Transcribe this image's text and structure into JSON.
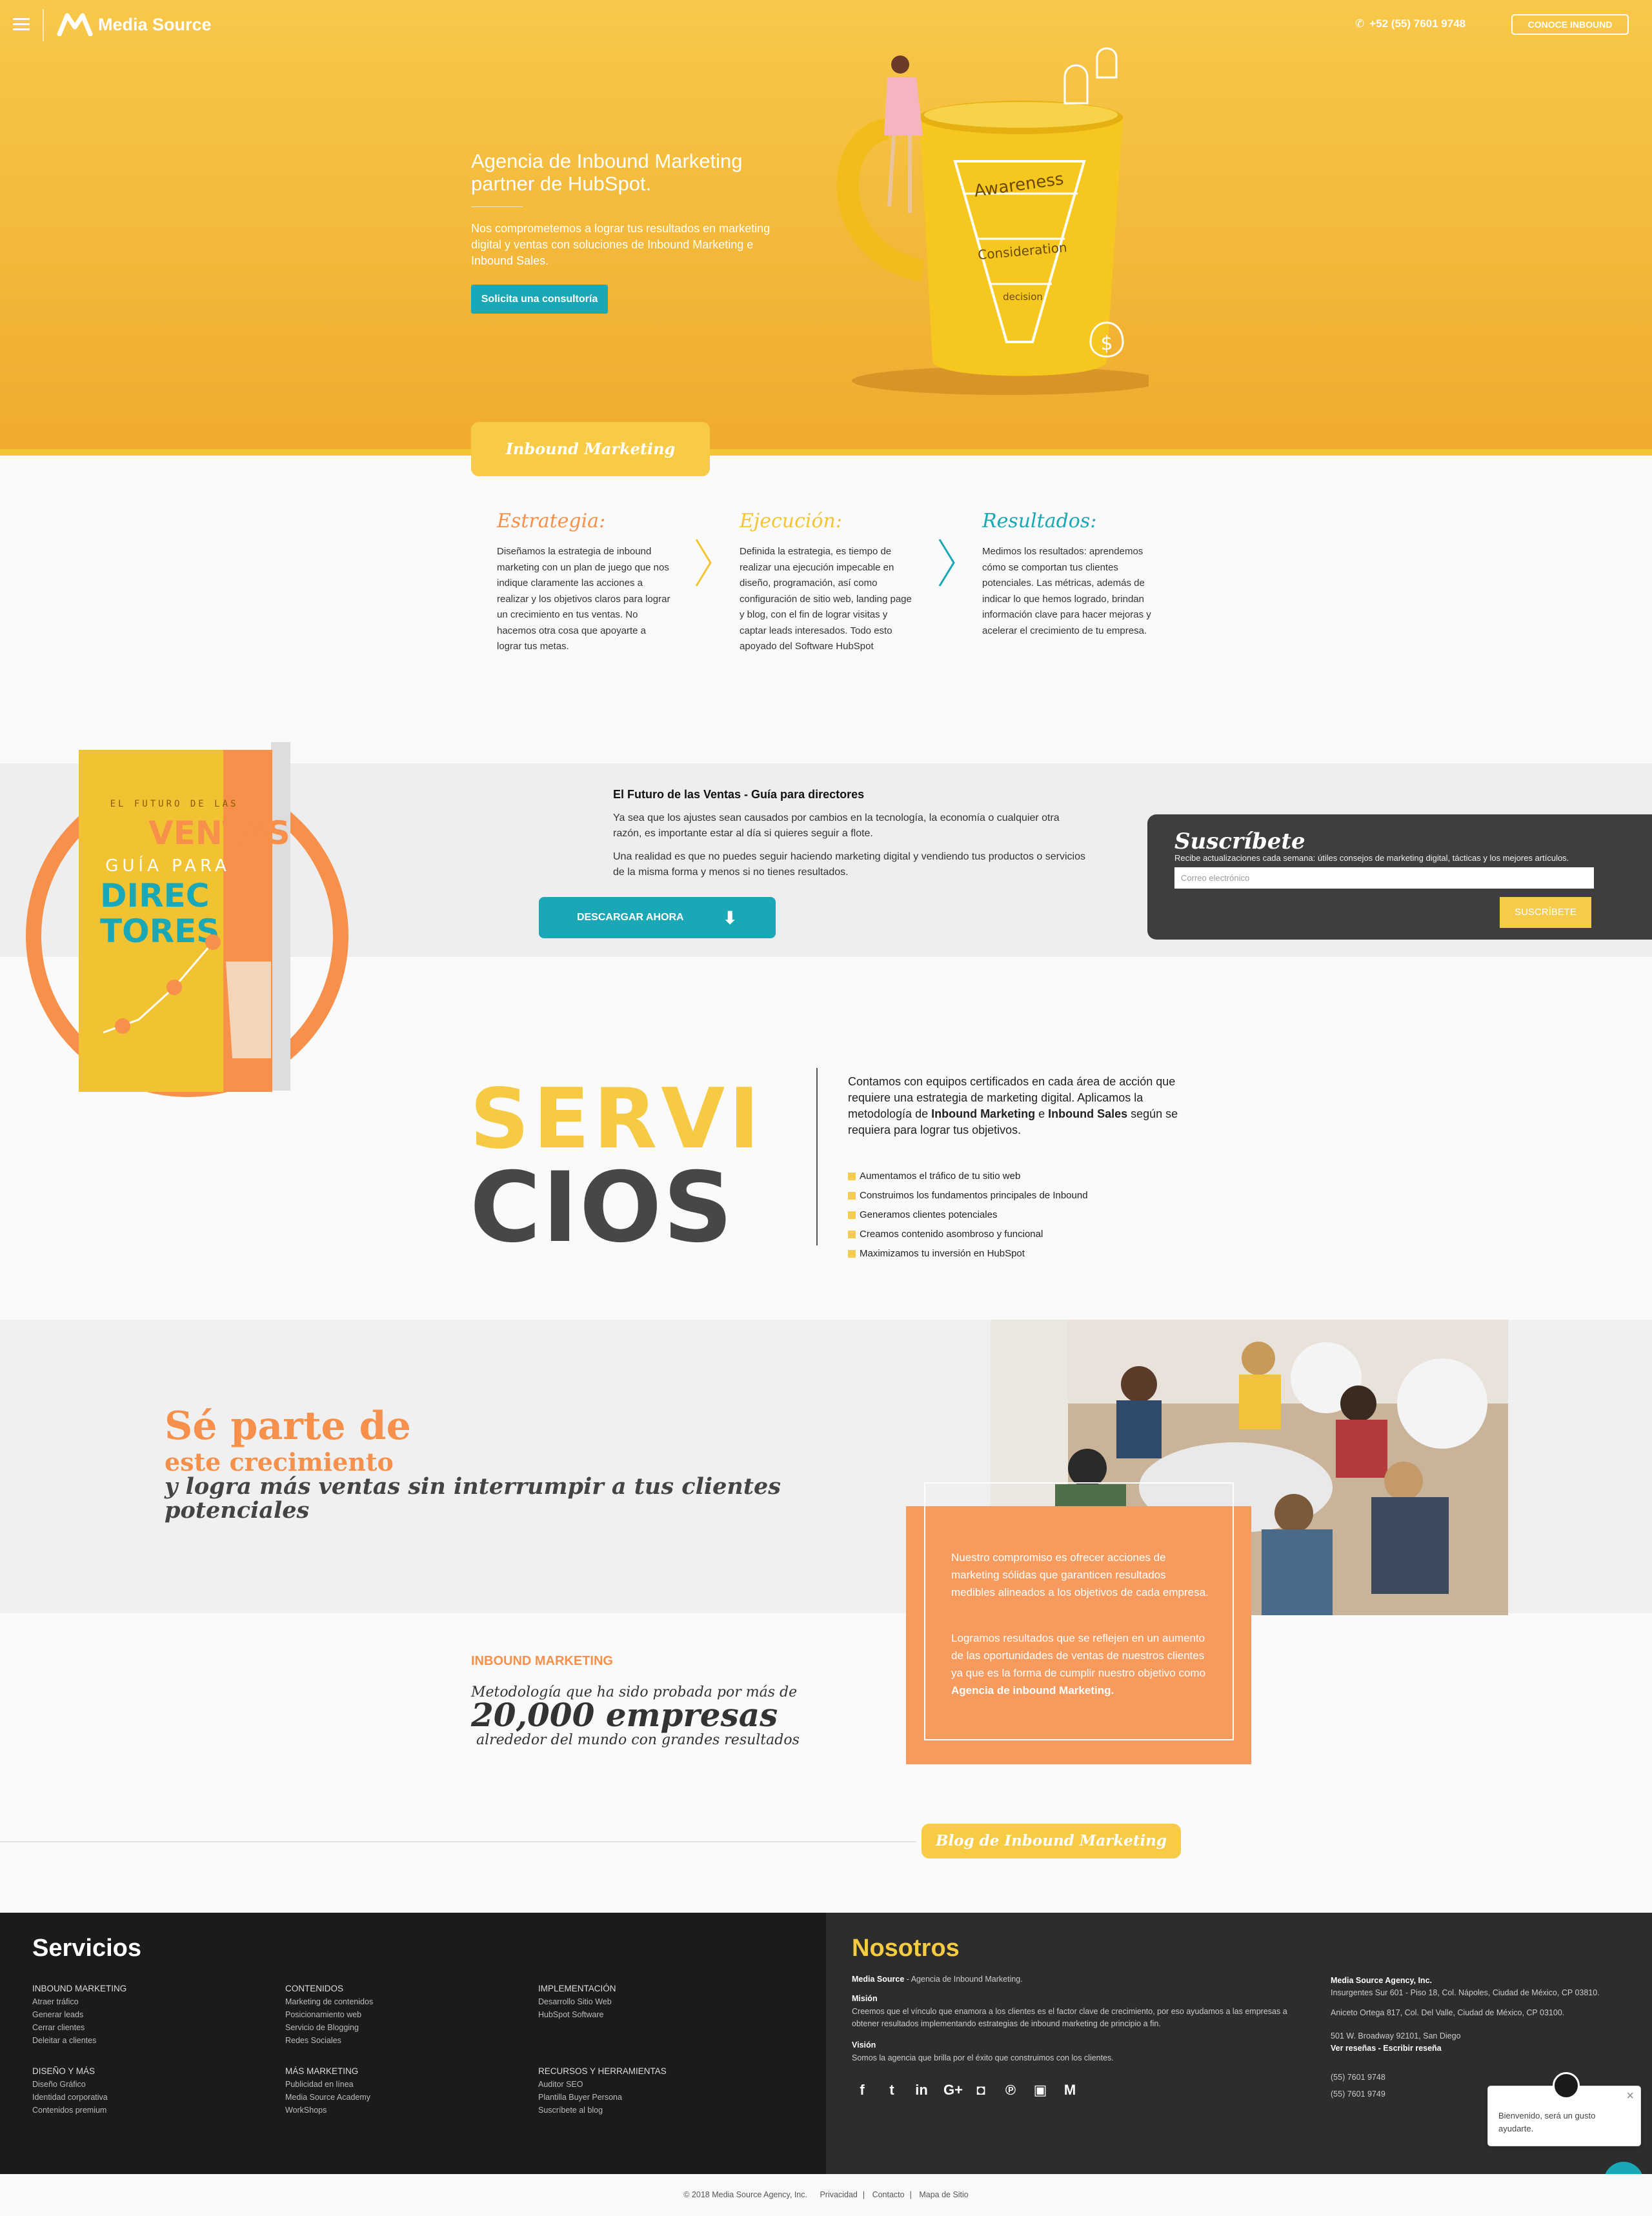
{
  "header": {
    "brand": "Media Source",
    "phone": "+52 (55) 7601 9748",
    "cta": "CONOCE INBOUND"
  },
  "hero": {
    "title": "Agencia de Inbound Marketing partner de HubSpot.",
    "text": "Nos comprometemos a lograr tus resultados en marketing digital y ventas con soluciones de Inbound Marketing e Inbound Sales.",
    "button": "Solicita una consultoría",
    "funnel": [
      "Awareness",
      "Consideration",
      "decision"
    ]
  },
  "section_tab": "Inbound Marketing",
  "steps": [
    {
      "title": "Estrategia:",
      "color": "#f6904a",
      "text": "Diseñamos la estrategia de inbound marketing con un plan de juego que nos indique claramente las acciones a realizar y los objetivos claros para lograr un crecimiento en tus ventas. No hacemos otra cosa que apoyarte a lograr tus metas."
    },
    {
      "title": "Ejecución:",
      "color": "#f3c535",
      "text": "Definida la estrategia, es tiempo de realizar una ejecución impecable en diseño, programación, así como configuración de sitio web, landing page y blog, con el fin de lograr visitas y captar leads interesados. Todo esto apoyado del Software HubSpot"
    },
    {
      "title": "Resultados:",
      "color": "#1aa7b6",
      "text": "Medimos los resultados: aprendemos cómo se comportan tus clientes potenciales. Las métricas, además de indicar lo que hemos logrado, brindan información clave para hacer mejoras y acelerar el crecimiento de tu empresa."
    }
  ],
  "ebook": {
    "cover_lines": [
      "EL FUTURO DE LAS",
      "VENTAS",
      "GUÍA PARA",
      "DIREC",
      "TORES"
    ],
    "title": "El Futuro de las Ventas - Guía para directores",
    "p1": "Ya sea que los ajustes sean causados por cambios en la tecnología, la economía o cualquier otra razón, es importante estar al día si quieres seguir a flote.",
    "p2": "Una realidad es que no puedes seguir haciendo marketing digital y vendiendo tus productos o servicios de la misma forma y menos si no tienes resultados.",
    "button": "DESCARGAR AHORA"
  },
  "subscribe": {
    "title": "Suscríbete",
    "desc": "Recibe actualizaciones cada semana: útiles consejos de marketing digital, tácticas y los mejores artículos.",
    "placeholder": "Correo electrónico",
    "button": "SUSCRÍBETE"
  },
  "services": {
    "word1": "SERVI",
    "word2": "CIOS",
    "text_pre": "Contamos con equipos certificados en cada área de acción que requiere una estrategia de marketing digital. Aplicamos la metodología de ",
    "text_b1": "Inbound Marketing",
    "text_mid": " e ",
    "text_b2": "Inbound Sales",
    "text_post": " según se requiera para lograr tus objetivos.",
    "items": [
      "Aumentamos el tráfico de tu sitio web",
      "Construimos los fundamentos principales de Inbound",
      "Generamos clientes potenciales",
      "Creamos contenido asombroso y funcional",
      "Maximizamos tu inversión en HubSpot"
    ]
  },
  "growth": {
    "line1": "Sé parte de",
    "line2": "este crecimiento",
    "line3": "y logra más ventas sin interrumpir a tus clientes potenciales",
    "box_p1": "Nuestro compromiso es ofrecer acciones de marketing sólidas que garanticen resultados medibles alineados a los objetivos de cada empresa.",
    "box_p2_pre": "Logramos resultados que se reflejen en un aumento de las oportunidades de ventas de nuestros clientes ya que es la forma de cumplir nuestro objetivo como ",
    "box_p2_b": "Agencia de inbound Marketing."
  },
  "inbound_stats": {
    "label": "INBOUND MARKETING",
    "line1": "Metodología que ha sido probada por más de",
    "big": "20,000 empresas",
    "line3": "alrededor del mundo con grandes resultados"
  },
  "blog_tab": "Blog de Inbound Marketing",
  "footer": {
    "servicios_title": "Servicios",
    "cols": [
      {
        "head": "INBOUND MARKETING",
        "items": [
          "Atraer tráfico",
          "Generar leads",
          "Cerrar clientes",
          "Deleitar a clientes"
        ]
      },
      {
        "head": "CONTENIDOS",
        "items": [
          "Marketing de contenidos",
          "Posicionamiento web",
          "Servicio de Blogging",
          "Redes Sociales"
        ]
      },
      {
        "head": "IMPLEMENTACIÓN",
        "items": [
          "Desarrollo Sitio Web",
          "HubSpot Software"
        ]
      },
      {
        "head": "DISEÑO Y MÁS",
        "items": [
          "Diseño Gráfico",
          "Identidad corporativa",
          "Contenidos premium"
        ]
      },
      {
        "head": "MÁS MARKETING",
        "items": [
          "Publicidad en línea",
          "Media Source Academy",
          "WorkShops"
        ]
      },
      {
        "head": "RECURSOS Y HERRAMIENTAS",
        "items": [
          "Auditor SEO",
          "Plantilla Buyer Persona",
          "Suscríbete al blog"
        ]
      }
    ],
    "nosotros_title": "Nosotros",
    "about_b": "Media Source",
    "about": " -  Agencia de Inbound Marketing.",
    "mision_h": "Misión",
    "mision": "Creemos que el vínculo que enamora a los clientes es el factor clave de crecimiento, por eso ayudamos a las empresas a obtener resultados implementando estrategias de inbound marketing de principio a fin.",
    "vision_h": "Visión",
    "vision": "Somos la agencia que brilla por el éxito que construimos con los clientes.",
    "company": "Media Source Agency, Inc.",
    "addr1": "Insurgentes Sur 601 - Piso 18, Col. Nápoles, Ciudad de México, CP 03810.",
    "addr2": "Aniceto Ortega 817, Col. Del Valle, Ciudad de México, CP 03100.",
    "addr3": "501 W. Broadway 92101, San Diego",
    "reviews": "Ver reseñas - Escribir reseña",
    "phone1": "(55) 7601 9748",
    "phone2": "(55) 7601 9749",
    "social_icons": [
      "facebook-icon",
      "twitter-icon",
      "linkedin-icon",
      "googleplus-icon",
      "instagram-icon",
      "pinterest-icon",
      "slideshare-icon",
      "mediasource-icon"
    ]
  },
  "chat": {
    "message": "Bienvenido, será un gusto ayudarte."
  },
  "bottom": {
    "copyright": "© 2018 Media Source Agency, Inc.",
    "links": [
      "Privacidad",
      "Contacto",
      "Mapa de Sitio"
    ]
  }
}
